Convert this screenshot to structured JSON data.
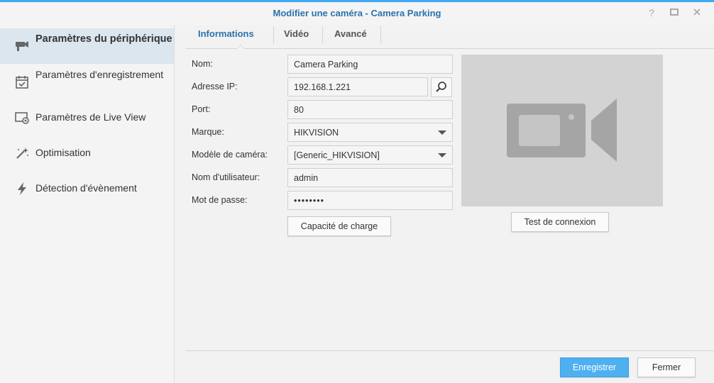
{
  "window": {
    "title": "Modifier une caméra - Camera Parking",
    "controls": {
      "help": "?",
      "maximize": "□",
      "close": "×"
    }
  },
  "colors": {
    "accent": "#3fa9f5",
    "title": "#2a73ad",
    "active_sidebar": "#dbe6ef",
    "primary_button": "#4fb0f0"
  },
  "sidebar": {
    "items": [
      {
        "label": "Paramètres du périphérique",
        "icon": "camera-icon",
        "active": true
      },
      {
        "label": "Paramètres d'enregistrement",
        "icon": "calendar-check-icon",
        "active": false
      },
      {
        "label": "Paramètres de Live View",
        "icon": "monitor-camera-icon",
        "active": false
      },
      {
        "label": "Optimisation",
        "icon": "magic-wand-icon",
        "active": false
      },
      {
        "label": "Détection d'évènement",
        "icon": "lightning-icon",
        "active": false
      }
    ]
  },
  "tabs": [
    {
      "label": "Informations",
      "active": true
    },
    {
      "label": "Vidéo",
      "active": false
    },
    {
      "label": "Avancé",
      "active": false
    }
  ],
  "form": {
    "name_label": "Nom:",
    "name_value": "Camera Parking",
    "ip_label": "Adresse IP:",
    "ip_value": "192.168.1.221",
    "port_label": "Port:",
    "port_value": "80",
    "brand_label": "Marque:",
    "brand_value": "HIKVISION",
    "model_label": "Modèle de caméra:",
    "model_value": "[Generic_HIKVISION]",
    "user_label": "Nom d'utilisateur:",
    "user_value": "admin",
    "password_label": "Mot de passe:",
    "password_value": "••••••••",
    "capacity_button": "Capacité de charge"
  },
  "preview": {
    "test_button": "Test de connexion"
  },
  "footer": {
    "save_button": "Enregistrer",
    "close_button": "Fermer"
  }
}
